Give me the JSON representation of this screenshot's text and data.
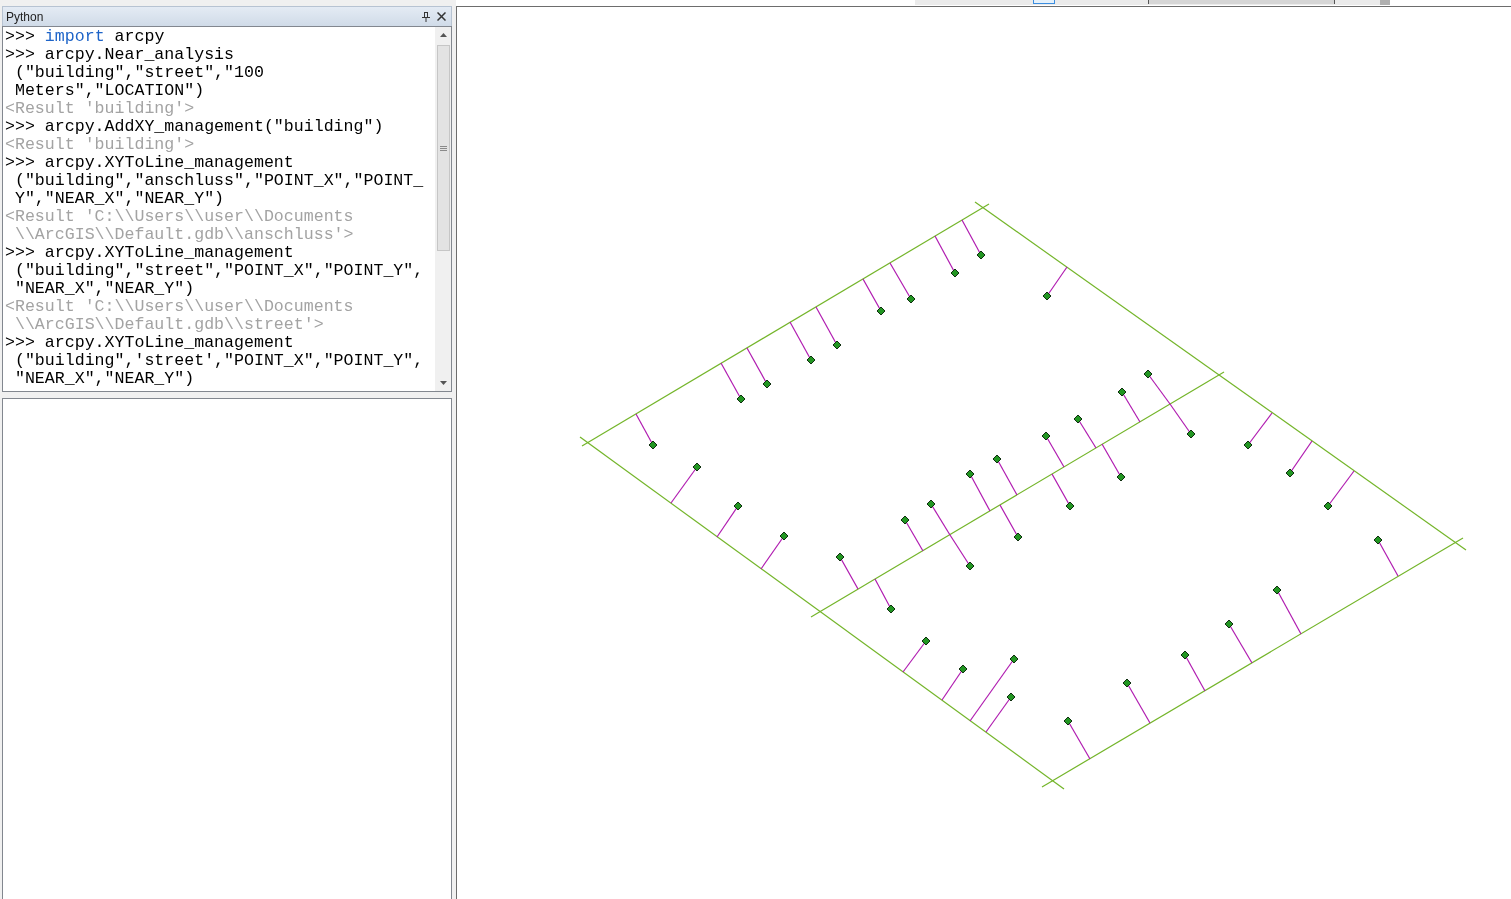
{
  "python_window": {
    "title": "Python",
    "console_lines": [
      {
        "kind": "command",
        "tokens": [
          {
            "text": ">>> ",
            "kind": "plain"
          },
          {
            "text": "import",
            "kind": "keyword"
          },
          {
            "text": " arcpy",
            "kind": "plain"
          }
        ]
      },
      {
        "kind": "command",
        "text": ">>> arcpy.Near_analysis"
      },
      {
        "kind": "command",
        "text": " (\"building\",\"street\",\"100"
      },
      {
        "kind": "command",
        "text": " Meters\",\"LOCATION\")"
      },
      {
        "kind": "result",
        "text": "<Result 'building'>"
      },
      {
        "kind": "command",
        "text": ">>> arcpy.AddXY_management(\"building\")"
      },
      {
        "kind": "result",
        "text": "<Result 'building'>"
      },
      {
        "kind": "command",
        "text": ">>> arcpy.XYToLine_management"
      },
      {
        "kind": "command",
        "text": " (\"building\",\"anschluss\",\"POINT_X\",\"POINT_"
      },
      {
        "kind": "command",
        "text": " Y\",\"NEAR_X\",\"NEAR_Y\")"
      },
      {
        "kind": "result",
        "text": "<Result 'C:\\\\Users\\\\user\\\\Documents"
      },
      {
        "kind": "result",
        "text": " \\\\ArcGIS\\\\Default.gdb\\\\anschluss'>"
      },
      {
        "kind": "command",
        "text": ">>> arcpy.XYToLine_management"
      },
      {
        "kind": "command",
        "text": " (\"building\",\"street\",\"POINT_X\",\"POINT_Y\","
      },
      {
        "kind": "command",
        "text": " \"NEAR_X\",\"NEAR_Y\")"
      },
      {
        "kind": "result",
        "text": "<Result 'C:\\\\Users\\\\user\\\\Documents"
      },
      {
        "kind": "result",
        "text": " \\\\ArcGIS\\\\Default.gdb\\\\street'>"
      },
      {
        "kind": "command",
        "text": ">>> arcpy.XYToLine_management"
      },
      {
        "kind": "command",
        "text": " (\"building\",'street',\"POINT_X\",\"POINT_Y\","
      },
      {
        "kind": "command",
        "text": " \"NEAR_X\",\"NEAR_Y\")"
      }
    ]
  }
}
